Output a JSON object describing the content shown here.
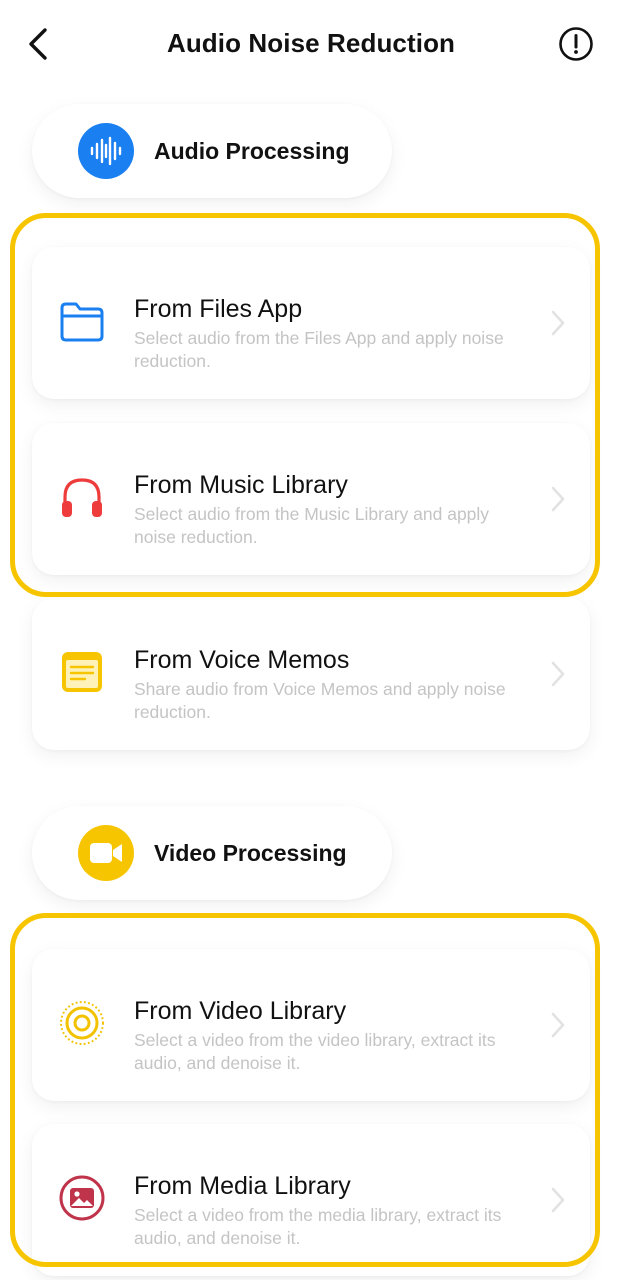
{
  "header": {
    "title": "Audio Noise Reduction"
  },
  "sections": {
    "audio": {
      "label": "Audio Processing",
      "icon": "waveform-icon",
      "color": "#1a7ff0"
    },
    "video": {
      "label": "Video Processing",
      "icon": "video-camera-icon",
      "color": "#f7c500"
    }
  },
  "items": {
    "files": {
      "title": "From Files App",
      "desc": "Select audio from the Files App and apply noise reduction.",
      "icon": "folder-icon",
      "color": "#1a7ff0"
    },
    "music": {
      "title": "From Music Library",
      "desc": "Select audio from the Music Library and apply noise reduction.",
      "icon": "headphones-icon",
      "color": "#ee3b3b"
    },
    "voice": {
      "title": "From Voice Memos",
      "desc": "Share audio from Voice Memos and apply noise reduction.",
      "icon": "note-icon",
      "color": "#f7c500"
    },
    "video": {
      "title": "From Video Library",
      "desc": "Select a video from the video library, extract its audio, and denoise it.",
      "icon": "target-icon",
      "color": "#f2c200"
    },
    "media": {
      "title": "From Media Library",
      "desc": "Select a video from the media library, extract its audio, and denoise it.",
      "icon": "photo-icon",
      "color": "#c0344b"
    }
  },
  "highlight_color": "#f7c500"
}
